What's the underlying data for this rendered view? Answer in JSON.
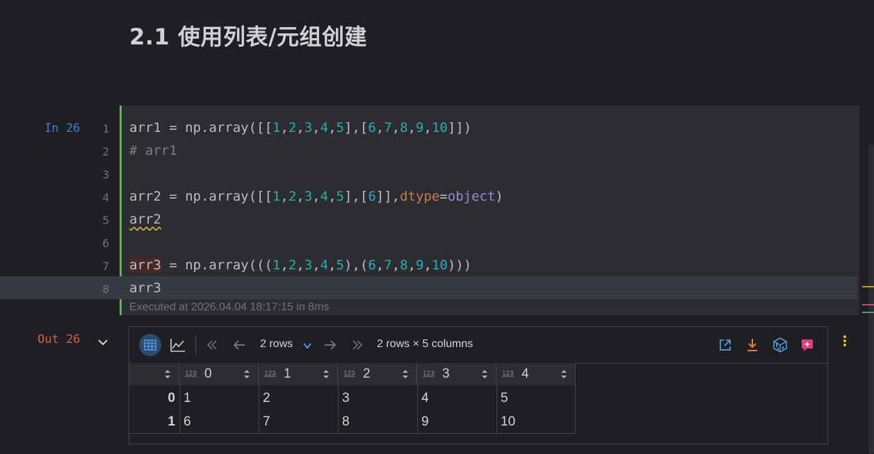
{
  "heading": "2.1 使用列表/元组创建",
  "cell": {
    "in_label": "In 26",
    "line_numbers": [
      "1",
      "2",
      "3",
      "4",
      "5",
      "6",
      "7",
      "8"
    ],
    "lines": {
      "l1": {
        "a": "arr1 = np.array([[",
        "n1": "1",
        ",": ",",
        "n2": "2",
        "n3": "3",
        "n4": "4",
        "n5": "5",
        "b": "],[",
        "n6": "6",
        "n7": "7",
        "n8": "8",
        "n9": "9",
        "n10": "10",
        "c": "]])"
      },
      "l2": "# arr1",
      "l4": {
        "a": "arr2 = np.array([[",
        "n1": "1",
        "n2": "2",
        "n3": "3",
        "n4": "4",
        "n5": "5",
        "b": "],[",
        "n6": "6",
        "c": "]],",
        "kw": "dtype",
        "eq": "=",
        "obj": "object",
        "d": ")"
      },
      "l5": "arr2",
      "l7": {
        "v": "arr3",
        "a": " = np.array(((",
        "n1": "1",
        "n2": "2",
        "n3": "3",
        "n4": "4",
        "n5": "5",
        "b": "),(",
        "n6": "6",
        "n7": "7",
        "n8": "8",
        "n9": "9",
        "n10": "10",
        "c": ")))"
      },
      "l8": "arr3"
    },
    "exec_info": "Executed at 2026.04.04 18:17:15 in 8ms"
  },
  "output": {
    "out_label": "Out 26",
    "rows_select": "2 rows",
    "shape": "2 rows × 5 columns",
    "type_badge": "123",
    "columns": [
      "0",
      "1",
      "2",
      "3",
      "4"
    ],
    "index": [
      "0",
      "1"
    ],
    "rows": [
      [
        "1",
        "2",
        "3",
        "4",
        "5"
      ],
      [
        "6",
        "7",
        "8",
        "9",
        "10"
      ]
    ]
  },
  "colors": {
    "accent_blue": "#3d7ecf",
    "number": "#2aacb8",
    "keyword_arg": "#c77d55",
    "out_red": "#db5c4b",
    "cell_border": "#5fb35f",
    "download_orange": "#e8833a",
    "pink": "#e0407a"
  }
}
